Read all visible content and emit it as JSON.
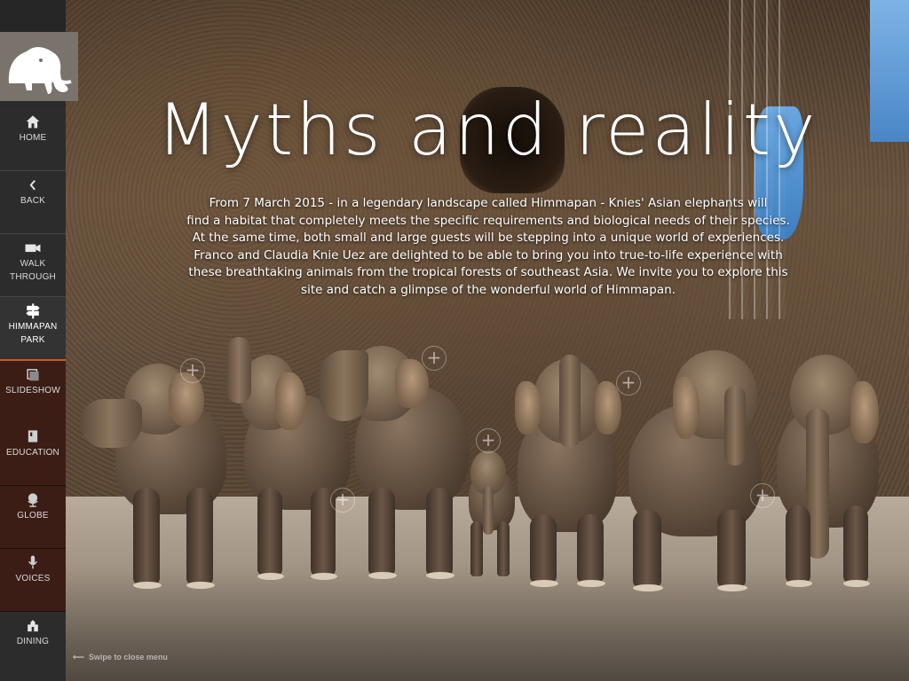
{
  "page": {
    "headline": "Myths and reality",
    "intro_lines": [
      "From 7 March 2015 - in a legendary landscape called Himmapan - Knies' Asian elephants will",
      "find a habitat that completely meets the specific requirements and biological needs of their species.",
      "At the same time, both small and large guests will be stepping into a unique world of experiences.",
      "Franco and Claudia Knie Uez are delighted to be able to bring you into true-to-life experience with",
      "these breathtaking animals from the tropical forests of southeast Asia. We invite you to explore this",
      "site and catch a glimpse of the wonderful world of Himmapan."
    ]
  },
  "sidebar": {
    "logo_icon": "mammoth-logo-icon",
    "items": [
      {
        "label_1": "HOME",
        "label_2": "",
        "icon": "home-icon",
        "active": false
      },
      {
        "label_1": "BACK",
        "label_2": "",
        "icon": "chevron-left-icon",
        "active": false
      },
      {
        "label_1": "WALK",
        "label_2": "THROUGH",
        "icon": "video-camera-icon",
        "active": false
      },
      {
        "label_1": "HIMMAPAN",
        "label_2": "PARK",
        "icon": "signpost-icon",
        "active": true
      },
      {
        "label_1": "SLIDESHOW",
        "label_2": "",
        "icon": "slideshow-icon",
        "active": false
      },
      {
        "label_1": "EDUCATION",
        "label_2": "",
        "icon": "book-icon",
        "active": false
      },
      {
        "label_1": "GLOBE",
        "label_2": "",
        "icon": "globe-icon",
        "active": false
      },
      {
        "label_1": "VOICES",
        "label_2": "",
        "icon": "microphone-icon",
        "active": false
      },
      {
        "label_1": "DINING",
        "label_2": "",
        "icon": "dining-icon",
        "active": false
      }
    ],
    "swipe_hint": "Swipe to close menu"
  },
  "colors": {
    "accent": "#c9582a",
    "sidebar_bg": "#2a2a2a",
    "sidebar_brown": "#3b1d16",
    "logo_bg": "#7a736c"
  }
}
